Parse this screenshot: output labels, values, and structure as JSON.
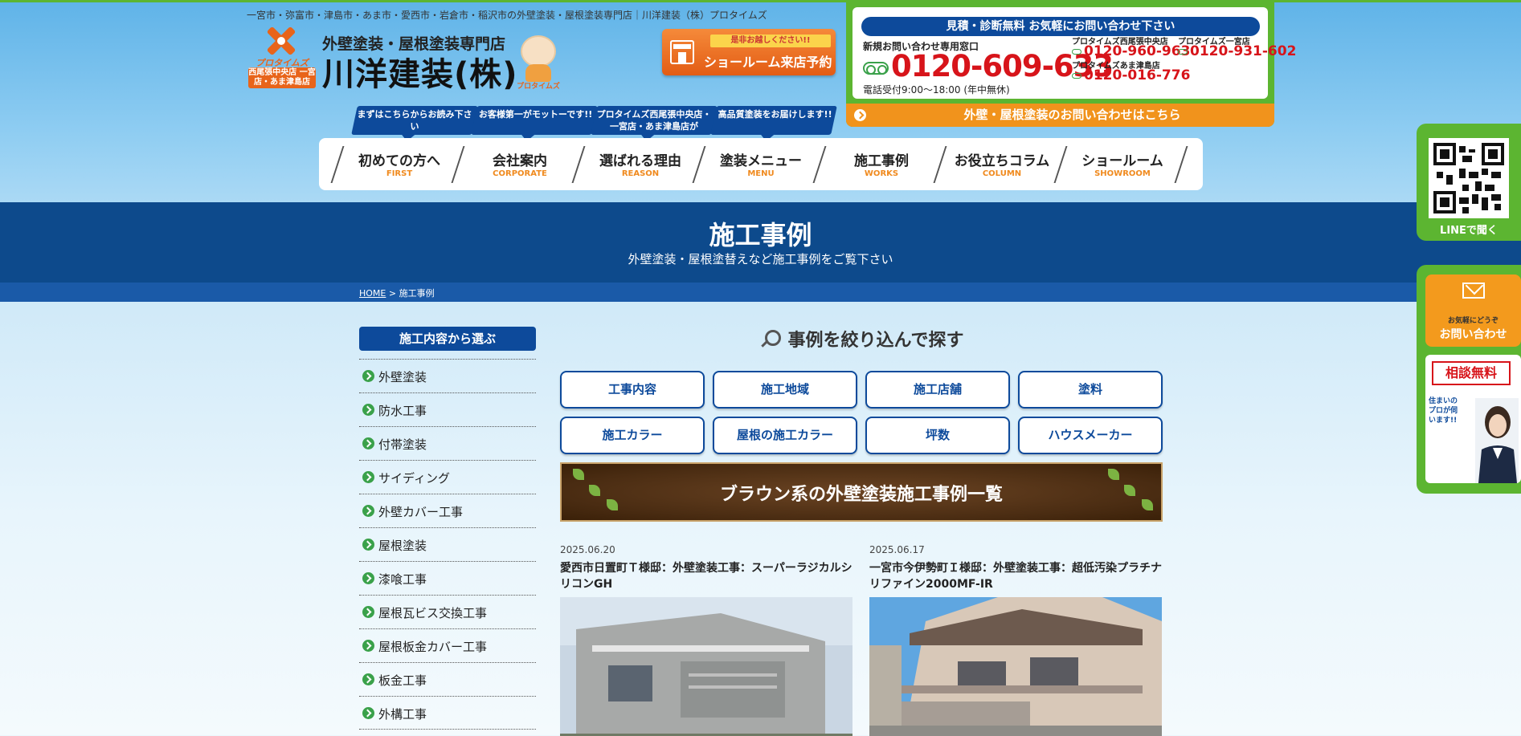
{
  "header": {
    "tagline": "一宮市・弥富市・津島市・あま市・愛西市・岩倉市・稲沢市の外壁塗装・屋根塗装専門店｜川洋建装（株）プロタイムズ",
    "logo_brand": "プロタイムズ",
    "logo_sub": "西尾張中央店 一宮店・あま津島店",
    "company_sub": "外壁塗装・屋根塗装専門店",
    "company_name": "川洋建装(株)",
    "mascot_caption": "プロタイムズ",
    "showroom_note": "是非お越しください!!",
    "showroom_label": "ショールーム来店予約"
  },
  "contact": {
    "title": "見積・診断無料 お気軽にお問い合わせ下さい",
    "main_label": "新規お問い合わせ専用窓口",
    "main_tel": "0120-609-633",
    "hours": "電話受付9:00～18:00 (年中無休)",
    "branches": [
      {
        "name": "プロタイムズ西尾張中央店",
        "tel": "0120-960-963"
      },
      {
        "name": "プロタイムズ一宮店",
        "tel": "0120-931-602"
      },
      {
        "name": "プロタイムズあま津島店",
        "tel": "0120-016-776"
      }
    ],
    "bar_label": "外壁・屋根塗装のお問い合わせはこちら"
  },
  "speech_tabs": [
    "まずはこちらからお読み下さい",
    "お客様第一がモットーです!!",
    "プロタイムズ西尾張中央店・一宮店・あま津島店が",
    "高品質塗装をお届けします!!"
  ],
  "nav": [
    {
      "jp": "初めての方へ",
      "en": "FIRST"
    },
    {
      "jp": "会社案内",
      "en": "CORPORATE"
    },
    {
      "jp": "選ばれる理由",
      "en": "REASON"
    },
    {
      "jp": "塗装メニュー",
      "en": "MENU"
    },
    {
      "jp": "施工事例",
      "en": "WORKS"
    },
    {
      "jp": "お役立ちコラム",
      "en": "COLUMN"
    },
    {
      "jp": "ショールーム",
      "en": "SHOWROOM"
    }
  ],
  "page": {
    "title": "施工事例",
    "subtitle": "外壁塗装・屋根塗替えなど施工事例をご覧下さい",
    "breadcrumb_home": "HOME",
    "breadcrumb_sep": " > ",
    "breadcrumb_current": "施工事例"
  },
  "sidebar": {
    "title": "施工内容から選ぶ",
    "items": [
      "外壁塗装",
      "防水工事",
      "付帯塗装",
      "サイディング",
      "外壁カバー工事",
      "屋根塗装",
      "漆喰工事",
      "屋根瓦ビス交換工事",
      "屋根板金カバー工事",
      "板金工事",
      "外構工事"
    ]
  },
  "search": {
    "heading": "事例を絞り込んで探す",
    "filters": [
      "工事内容",
      "施工地域",
      "施工店舗",
      "塗料",
      "施工カラー",
      "屋根の施工カラー",
      "坪数",
      "ハウスメーカー"
    ]
  },
  "banner": {
    "title": "ブラウン系の外壁塗装施工事例一覧"
  },
  "cases": [
    {
      "date": "2025.06.20",
      "title": "愛西市日置町Ｔ様邸：外壁塗装工事：スーパーラジカルシリコンGH"
    },
    {
      "date": "2025.06.17",
      "title": "一宮市今伊勢町Ｉ様邸：外壁塗装工事：超低汚染プラチナリファイン2000MF-IR"
    }
  ],
  "floating": {
    "line_label": "LINEで聞く",
    "inquiry_small": "お気軽にどうぞ",
    "inquiry_big": "お問い合わせ",
    "consult_badge": "相談無料",
    "consult_text": "住まいのプロが伺います!!"
  },
  "colors": {
    "brand_blue": "#0d4a9b",
    "brand_green": "#5cb531",
    "accent_orange": "#f1931c",
    "tel_red": "#d7141a"
  }
}
